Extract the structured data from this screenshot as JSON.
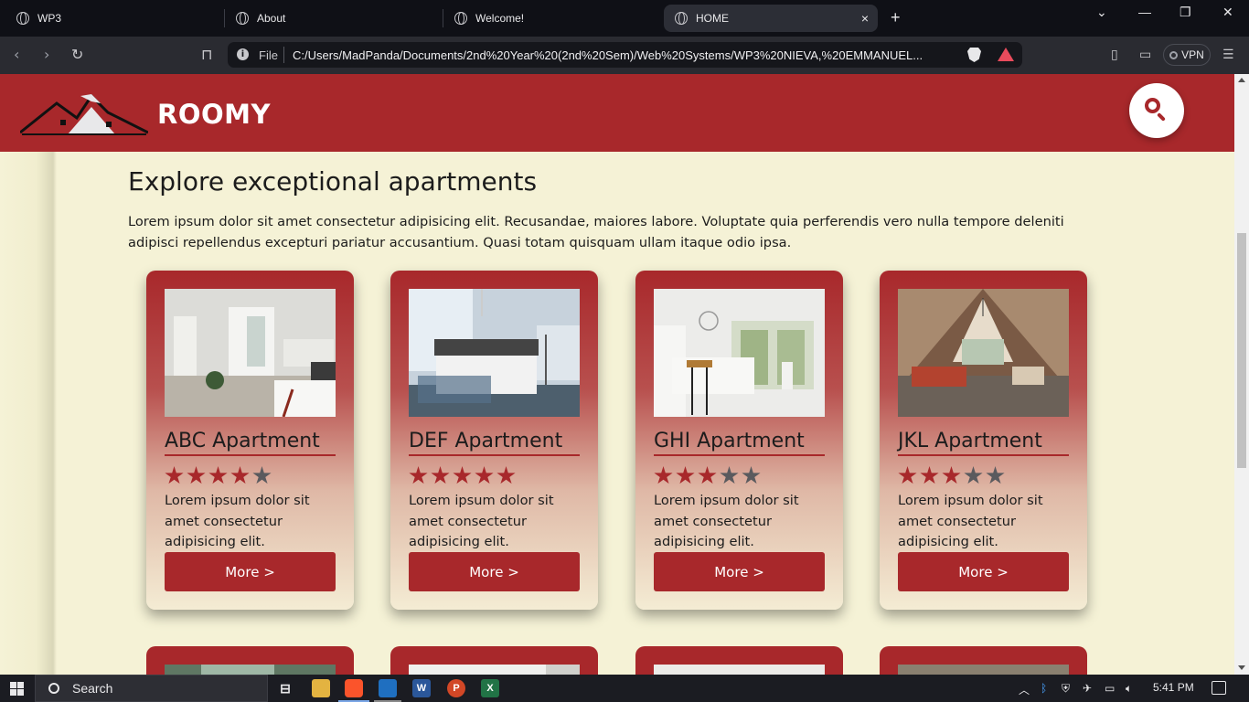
{
  "browser": {
    "tabs": [
      {
        "label": "WP3"
      },
      {
        "label": "About"
      },
      {
        "label": "Welcome!"
      },
      {
        "label": "HOME"
      }
    ],
    "file_label": "File",
    "url": "C:/Users/MadPanda/Documents/2nd%20Year%20(2nd%20Sem)/Web%20Systems/WP3%20NIEVA,%20EMMANUEL...",
    "vpn_label": "VPN",
    "new_tab": "+",
    "close_tab": "×"
  },
  "header": {
    "brand": "ROOMY"
  },
  "main": {
    "title": "Explore exceptional apartments",
    "description": "Lorem ipsum dolor sit amet consectetur adipisicing elit. Recusandae, maiores labore. Voluptate quia perferendis vero nulla tempore deleniti adipisci repellendus excepturi pariatur accusantium. Quasi totam quisquam ullam itaque odio ipsa.",
    "cards": [
      {
        "name": "ABC Apartment",
        "rating": 4,
        "max_rating": 5,
        "desc": "Lorem ipsum dolor sit amet consectetur adipisicing elit.",
        "button": "More >"
      },
      {
        "name": "DEF Apartment",
        "rating": 5,
        "max_rating": 5,
        "desc": "Lorem ipsum dolor sit amet consectetur adipisicing elit.",
        "button": "More >"
      },
      {
        "name": "GHI Apartment",
        "rating": 3,
        "max_rating": 5,
        "desc": "Lorem ipsum dolor sit amet consectetur adipisicing elit.",
        "button": "More >"
      },
      {
        "name": "JKL Apartment",
        "rating": 3,
        "max_rating": 5,
        "desc": "Lorem ipsum dolor sit amet consectetur adipisicing elit.",
        "button": "More >"
      }
    ]
  },
  "taskbar": {
    "search_label": "Search",
    "time": "5:41 PM"
  },
  "colors": {
    "brand_red": "#a8282b",
    "page_bg": "#f5f2d6",
    "star_off": "#5a5a5e"
  }
}
